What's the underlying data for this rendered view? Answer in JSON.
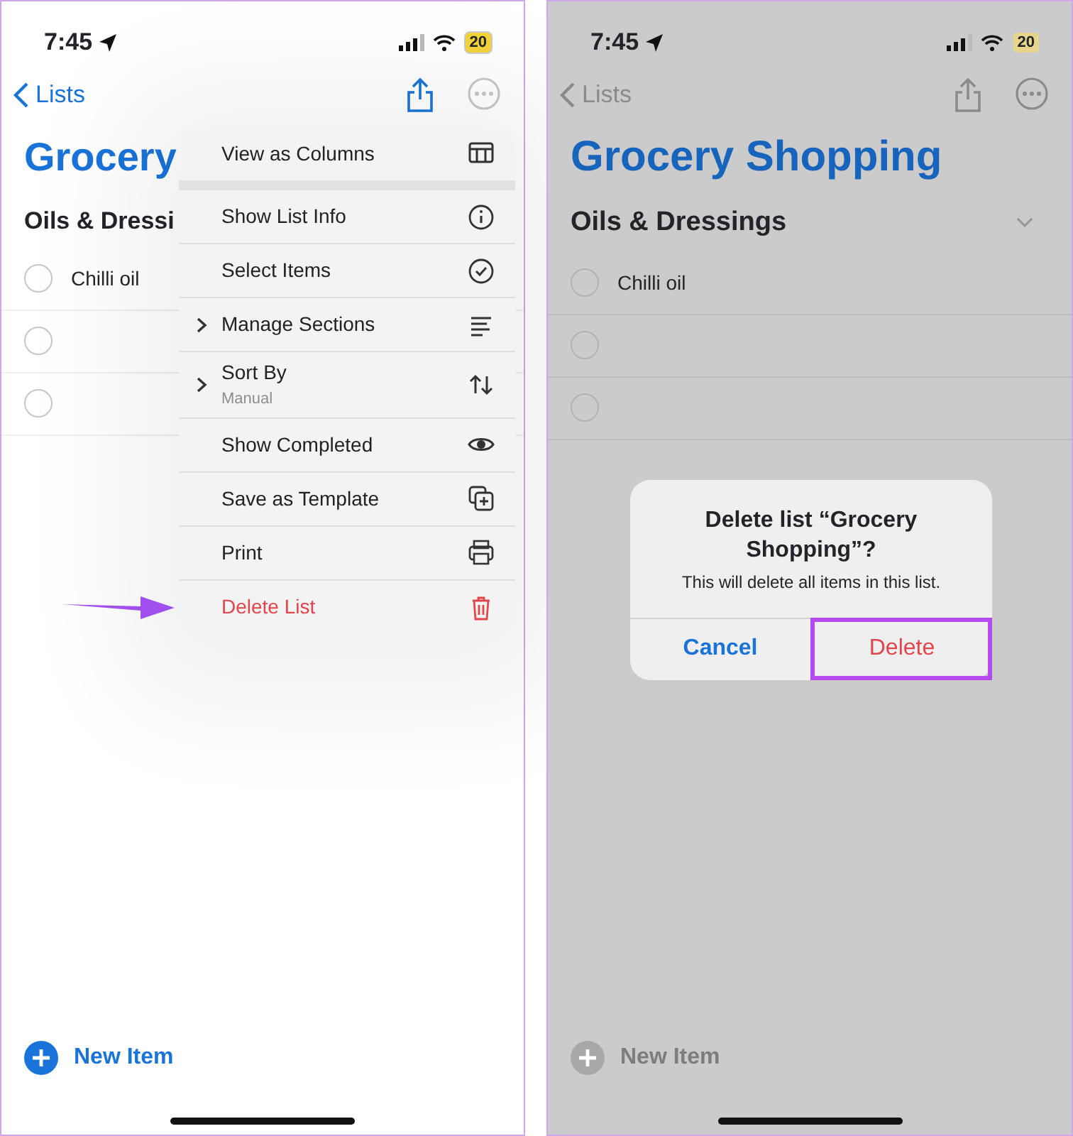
{
  "screens": [
    {
      "dimmed": false,
      "status_bar": {
        "time": "7:45",
        "battery": "20"
      },
      "nav": {
        "back": "Lists"
      },
      "title": "Grocery",
      "section": {
        "title": "Oils & Dressi"
      },
      "rows": [
        {
          "kind": "item",
          "text": "Chilli oil"
        },
        {
          "kind": "empty"
        },
        {
          "kind": "empty"
        }
      ],
      "new_item": "New Item",
      "menu": {
        "groups": [
          [
            {
              "label": "View as Columns",
              "submenu": false,
              "destructive": false,
              "pointed": false
            }
          ],
          [
            {
              "label": "Show List Info",
              "submenu": false,
              "destructive": false,
              "pointed": false
            },
            {
              "label": "Select Items",
              "submenu": false,
              "destructive": false,
              "pointed": false
            },
            {
              "label": "Manage Sections",
              "submenu": true,
              "destructive": false,
              "pointed": false
            },
            {
              "label": "Sort By",
              "sublabel": "Manual",
              "submenu": true,
              "destructive": false,
              "pointed": false
            },
            {
              "label": "Show Completed",
              "submenu": false,
              "destructive": false,
              "pointed": false
            },
            {
              "label": "Save as Template",
              "submenu": false,
              "destructive": false,
              "pointed": false
            },
            {
              "label": "Print",
              "submenu": false,
              "destructive": false,
              "pointed": false
            },
            {
              "label": "Delete List",
              "submenu": false,
              "destructive": true,
              "pointed": true
            }
          ]
        ]
      }
    },
    {
      "dimmed": true,
      "status_bar": {
        "time": "7:45",
        "battery": "20"
      },
      "nav": {
        "back": "Lists"
      },
      "title": "Grocery Shopping",
      "section": {
        "title": "Oils & Dressings",
        "expanded": true
      },
      "rows": [
        {
          "kind": "item",
          "text": "Chilli oil"
        },
        {
          "kind": "empty"
        },
        {
          "kind": "empty"
        }
      ],
      "new_item": "New Item",
      "dialog": {
        "title": "Delete list “Grocery Shopping”?",
        "message": "This will delete all items in this list.",
        "buttons": [
          {
            "label": "Cancel",
            "kind": "default",
            "highlighted": false
          },
          {
            "label": "Delete",
            "kind": "destructive",
            "highlighted": true
          }
        ]
      }
    }
  ]
}
